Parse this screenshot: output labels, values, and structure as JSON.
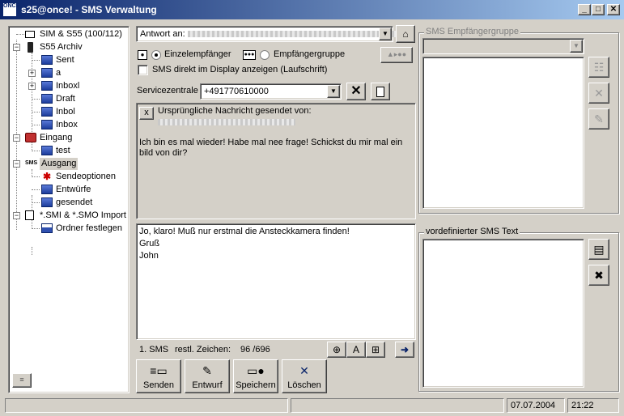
{
  "window": {
    "title": "s25@once!  -  SMS Verwaltung",
    "app_icon": "ONCE",
    "minimize": "_",
    "maximize": "□",
    "close": "✕"
  },
  "tree": {
    "items": [
      {
        "label": "SIM & S55 (100/112)",
        "icon": "sim-card-icon"
      },
      {
        "label": "S55 Archiv",
        "icon": "phone-icon"
      },
      {
        "label": "Sent",
        "icon": "folder-icon"
      },
      {
        "label": "a",
        "icon": "folder-icon"
      },
      {
        "label": "Inboxl",
        "icon": "folder-icon"
      },
      {
        "label": "Draft",
        "icon": "folder-icon"
      },
      {
        "label": "Inbol",
        "icon": "folder-icon"
      },
      {
        "label": "Inbox",
        "icon": "folder-icon"
      },
      {
        "label": "Eingang",
        "icon": "inbox-icon"
      },
      {
        "label": "test",
        "icon": "folder-icon"
      },
      {
        "label": "Ausgang",
        "icon": "outbox-icon"
      },
      {
        "label": "Sendeoptionen",
        "icon": "options-icon"
      },
      {
        "label": "Entwürfe",
        "icon": "folder-icon"
      },
      {
        "label": "gesendet",
        "icon": "folder-icon"
      },
      {
        "label": "*.SMI & *.SMO Import",
        "icon": "import-icon"
      },
      {
        "label": "Ordner festlegen",
        "icon": "folder-set-icon"
      }
    ]
  },
  "compose": {
    "reply_label": "Antwort an:",
    "radio_single": "Einzelempfänger",
    "radio_group": "Empfängergruppe",
    "checkbox_display": "SMS direkt im Display anzeigen (Laufschrift)",
    "service_center_label": "Servicezentrale",
    "service_center_value": "+491770610000",
    "orig_header": "Ursprüngliche Nachricht gesendet von:",
    "orig_close": "x",
    "orig_text": "Ich bin es mal wieder! Habe mal nee frage! Schickst du mir mal ein bild von dir?",
    "message_text": "Jo, klaro! Muß nur erstmal die Ansteckkamera finden!\nGruß\nJohn",
    "sms_count": "1. SMS",
    "remaining_label": "restl. Zeichen:",
    "remaining_value": "96 /696"
  },
  "buttons": {
    "send": "Senden",
    "draft": "Entwurf",
    "save": "Speichern",
    "delete": "Löschen"
  },
  "right": {
    "group_title": "SMS Empfängergruppe",
    "predefined_title": "vordefinierter SMS Text"
  },
  "status": {
    "date": "07.07.2004",
    "time": "21:22"
  }
}
